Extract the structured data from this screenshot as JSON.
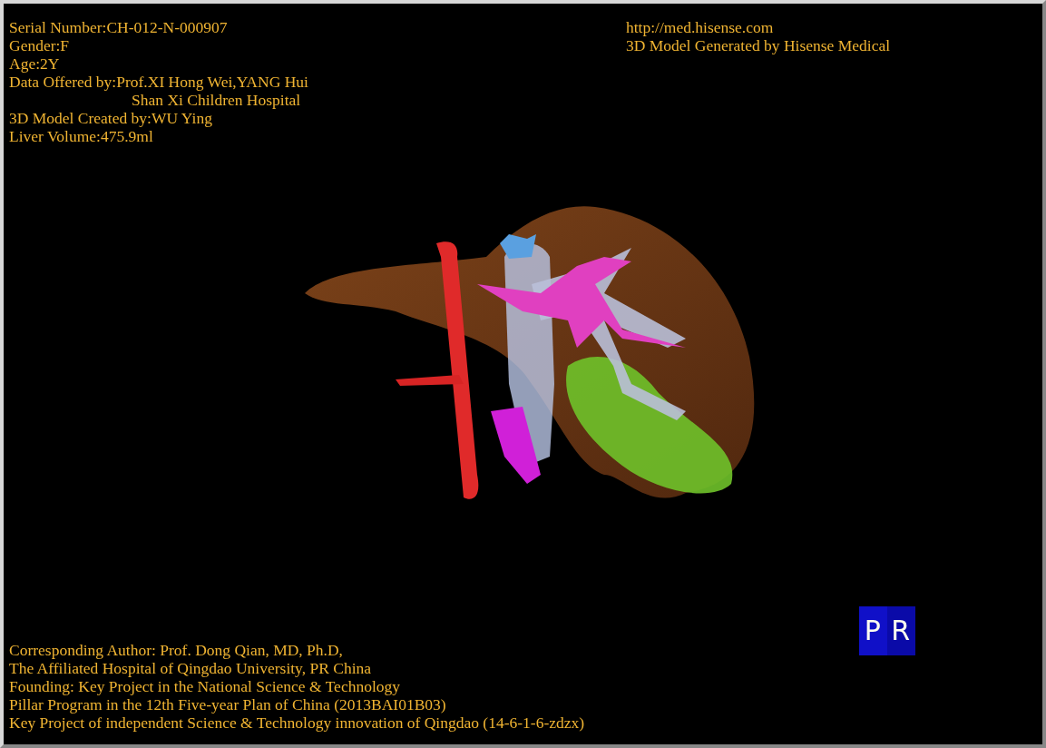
{
  "patient_info": [
    {
      "kind": "line",
      "text": "Serial Number:CH-012-N-000907"
    },
    {
      "kind": "line",
      "text": "Gender:F"
    },
    {
      "kind": "line",
      "text": "Age:2Y"
    },
    {
      "kind": "line",
      "text": "Data Offered by:Prof.XI Hong Wei,YANG Hui"
    },
    {
      "kind": "continuation",
      "text": "Shan Xi Children Hospital"
    },
    {
      "kind": "line",
      "text": "3D Model Created by:WU Ying"
    },
    {
      "kind": "line",
      "text": "Liver Volume:475.9ml"
    }
  ],
  "generator_info": [
    "http://med.hisense.com",
    "3D Model Generated by Hisense Medical"
  ],
  "orientation_cube": {
    "front": "P",
    "side": "R"
  },
  "credits": [
    "Corresponding Author: Prof. Dong Qian, MD, Ph.D,",
    "The Affiliated Hospital of Qingdao University, PR China",
    "Founding: Key Project in the National Science & Technology",
    "Pillar Program in the 12th Five-year Plan of China (2013BAI01B03)",
    "Key Project of independent Science & Technology innovation of Qingdao (14-6-1-6-zdzx)"
  ]
}
